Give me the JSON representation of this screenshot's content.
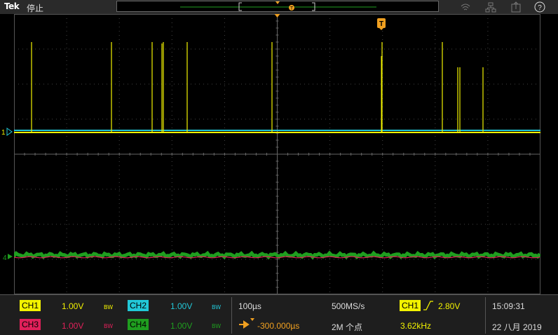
{
  "app": {
    "brand": "Tek",
    "run_state": "停止"
  },
  "channels": [
    {
      "id": "CH1",
      "scale": "1.00V",
      "bw": "BW",
      "color": "#f2f200",
      "badge_text": "#000"
    },
    {
      "id": "CH2",
      "scale": "1.00V",
      "bw": "BW",
      "color": "#22c8d8",
      "badge_text": "#000"
    },
    {
      "id": "CH3",
      "scale": "1.00V",
      "bw": "BW",
      "color": "#e0205a",
      "badge_text": "#000"
    },
    {
      "id": "CH4",
      "scale": "1.00V",
      "bw": "BW",
      "color": "#1f9e1f",
      "badge_text": "#000"
    }
  ],
  "horizontal": {
    "scale": "100µs",
    "position": "-300.000µs",
    "sample_rate": "500MS/s",
    "record_length": "2M 个点"
  },
  "trigger": {
    "source": "CH1",
    "level": "2.80V",
    "frequency": "3.62kHz",
    "marker": "T"
  },
  "clock": {
    "time": "15:09:31",
    "date": "22 八月 2019"
  },
  "markers": {
    "ch1_ground": "1",
    "ch4_ground": "4"
  },
  "icons": [
    "wifi-icon",
    "network-icon",
    "export-icon",
    "help-icon"
  ],
  "accent": "#f0a020"
}
